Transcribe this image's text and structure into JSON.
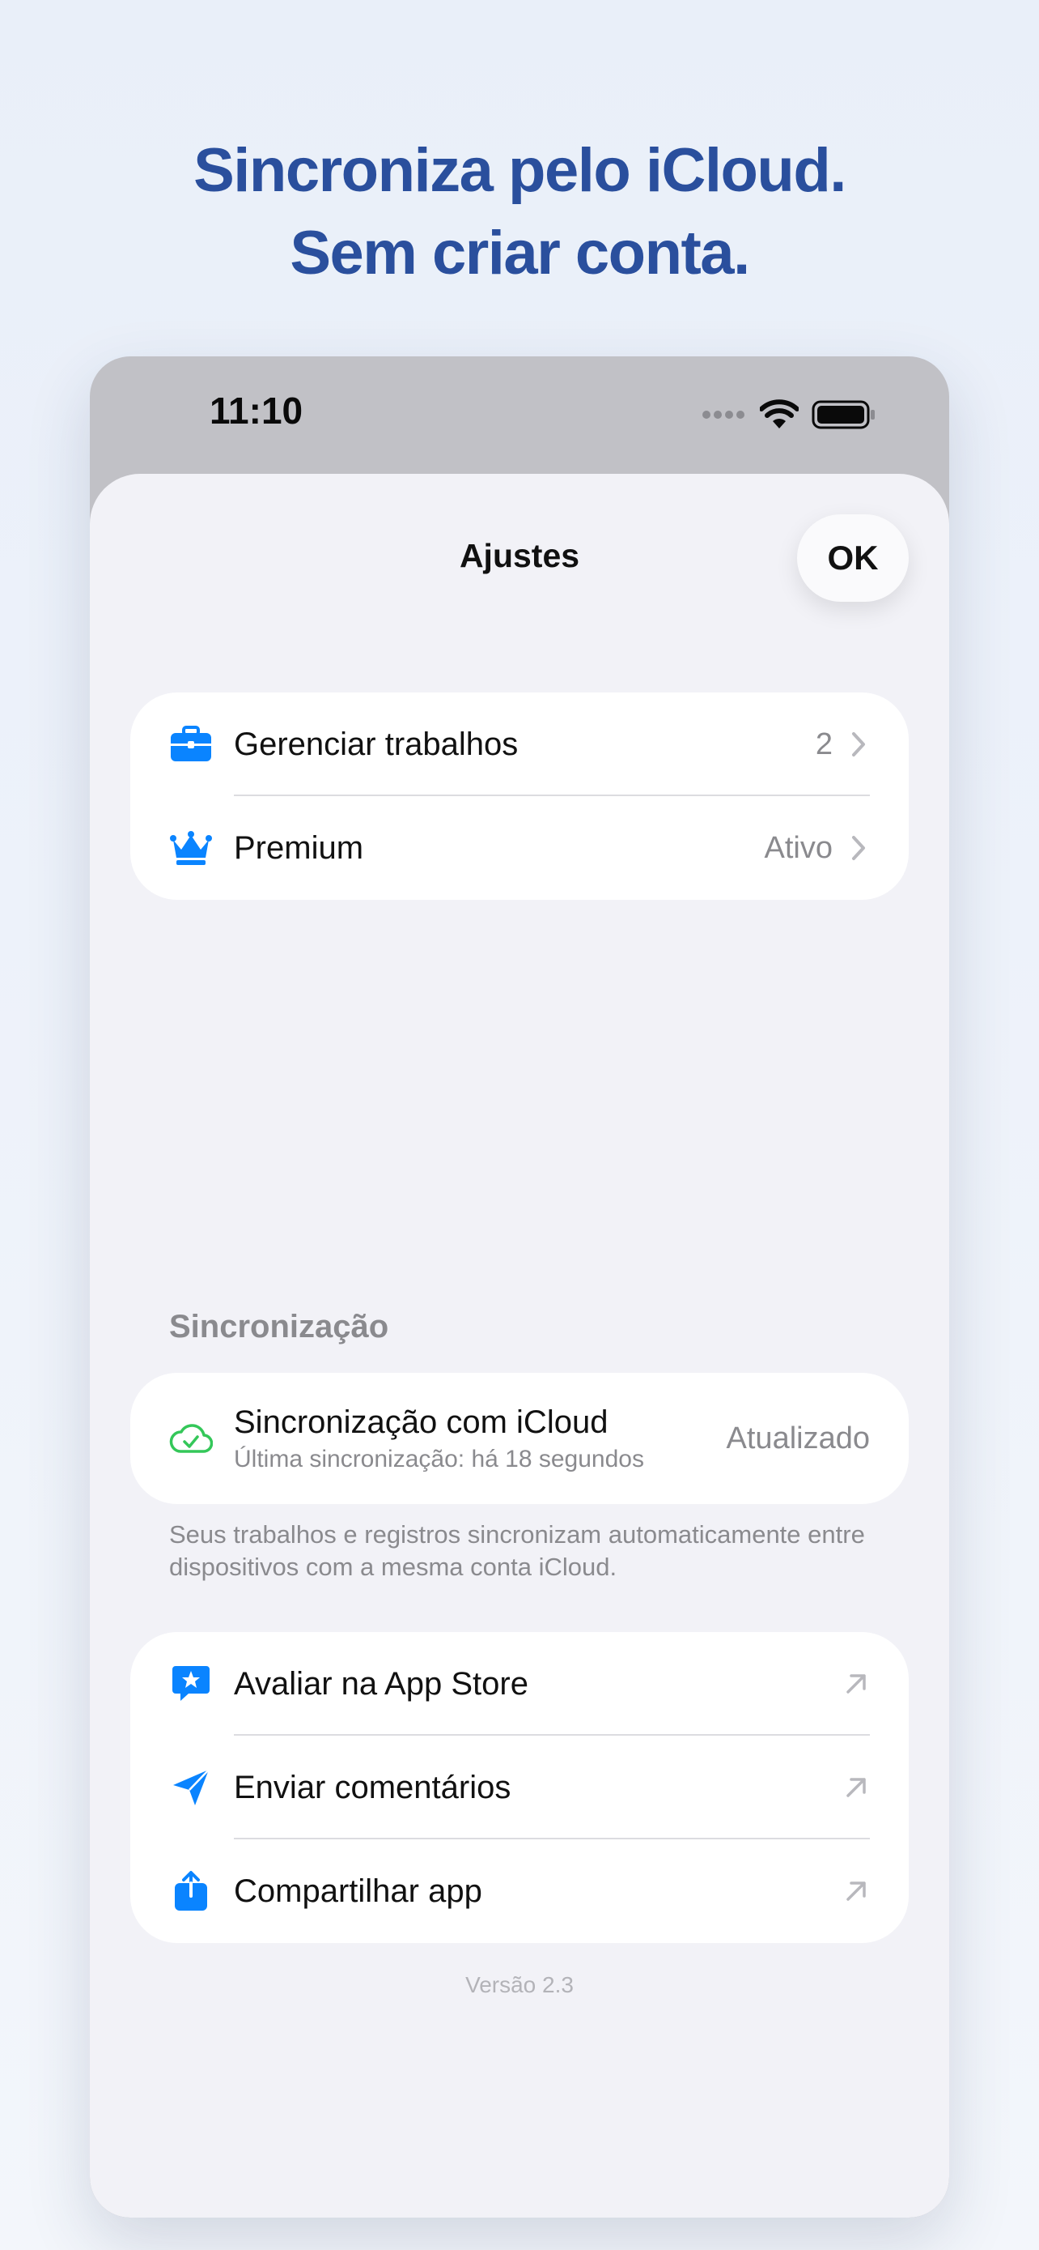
{
  "headline": {
    "line1": "Sincroniza pelo iCloud.",
    "line2": "Sem criar conta."
  },
  "status_bar": {
    "time": "11:10",
    "icons": [
      "signal-dots-icon",
      "wifi-icon",
      "battery-icon"
    ]
  },
  "sheet": {
    "title": "Ajustes",
    "ok_label": "OK"
  },
  "group1": [
    {
      "label": "Gerenciar trabalhos",
      "value": "2",
      "icon": "briefcase-icon"
    },
    {
      "label": "Premium",
      "value": "Ativo",
      "icon": "crown-icon"
    }
  ],
  "sync": {
    "header": "Sincronização",
    "title": "Sincronização com iCloud",
    "subtitle": "Última sincronização: há 18 segundos",
    "status": "Atualizado",
    "icon": "icloud-check-icon",
    "footer": "Seus trabalhos e registros sincronizam automaticamente entre dispositivos com a mesma conta iCloud."
  },
  "group3": [
    {
      "label": "Avaliar na App Store",
      "icon": "star-bubble-icon"
    },
    {
      "label": "Enviar comentários",
      "icon": "paper-plane-icon"
    },
    {
      "label": "Compartilhar app",
      "icon": "share-icon"
    }
  ],
  "version": "Versão 2.3",
  "colors": {
    "accent": "#0a84ff",
    "headline": "#2a4f9d",
    "success": "#34c759",
    "background": "#f2f2f7"
  }
}
